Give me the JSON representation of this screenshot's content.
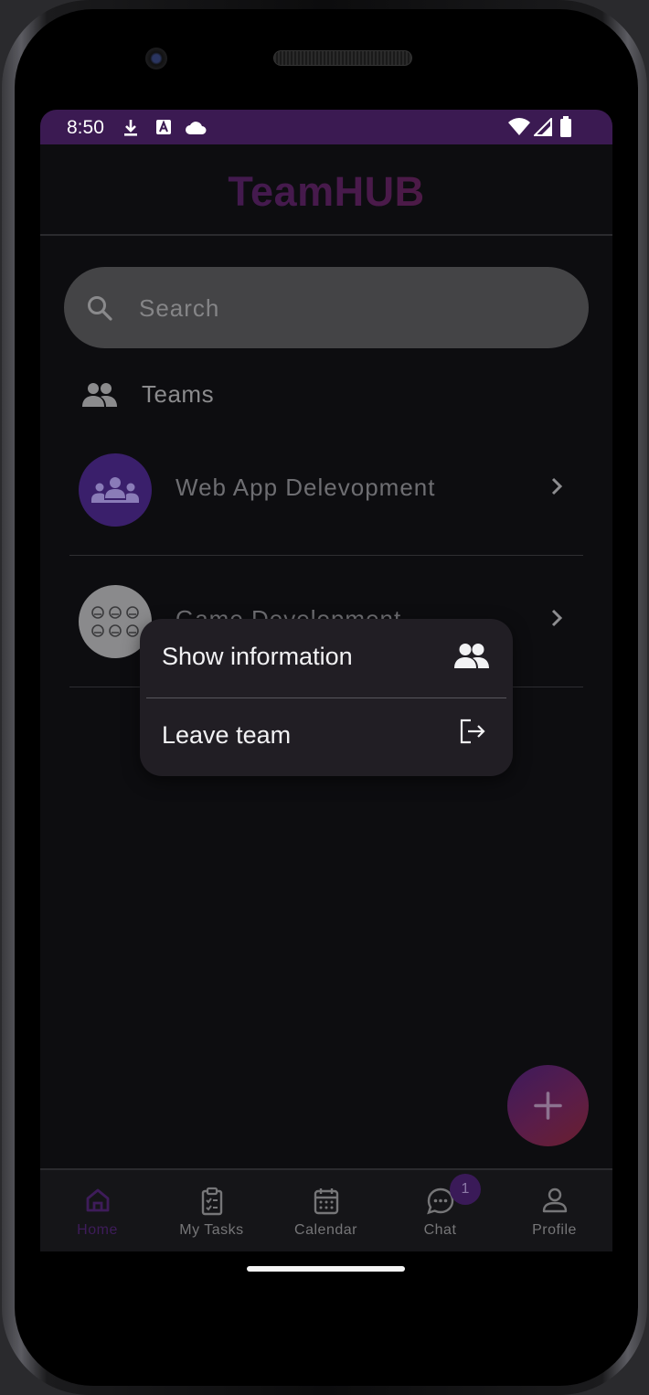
{
  "status_bar": {
    "time": "8:50",
    "left_icons": [
      "download-icon",
      "a-letter-icon",
      "cloud-icon"
    ],
    "right_icons": [
      "wifi-icon",
      "signal-icon",
      "battery-icon"
    ],
    "background": "#3b1a52"
  },
  "header": {
    "title": "TeamHUB"
  },
  "search": {
    "placeholder": "Search",
    "value": ""
  },
  "teams_section": {
    "label": "Teams",
    "icon": "people-icon",
    "items": [
      {
        "name": "Web App Delevopment",
        "avatar_icon": "group-icon",
        "avatar_color": "#3a1f6b"
      },
      {
        "name": "Game Development",
        "avatar_icon": "grid-faces-icon",
        "avatar_color": "#8a8a8c"
      }
    ]
  },
  "popup_menu": {
    "items": [
      {
        "label": "Show information",
        "icon": "people-icon"
      },
      {
        "label": "Leave team",
        "icon": "logout-icon"
      }
    ]
  },
  "fab": {
    "icon": "plus-icon"
  },
  "bottom_nav": {
    "items": [
      {
        "label": "Home",
        "icon": "home-icon",
        "active": true
      },
      {
        "label": "My Tasks",
        "icon": "clipboard-icon",
        "active": false
      },
      {
        "label": "Calendar",
        "icon": "calendar-icon",
        "active": false
      },
      {
        "label": "Chat",
        "icon": "chat-icon",
        "active": false,
        "badge": "1"
      },
      {
        "label": "Profile",
        "icon": "person-icon",
        "active": false
      }
    ]
  },
  "colors": {
    "accent": "#3e1c5a",
    "background": "#0d0d10",
    "popup": "#211e24"
  }
}
